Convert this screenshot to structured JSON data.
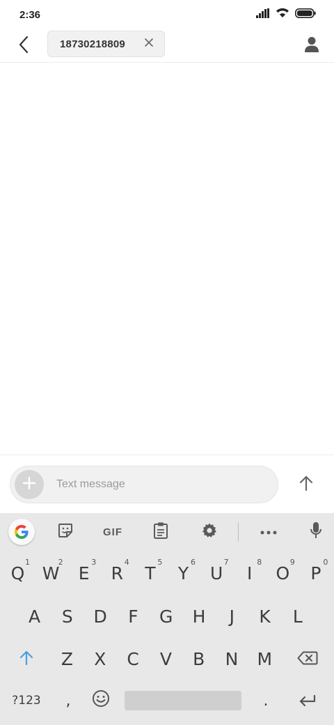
{
  "status_bar": {
    "time": "2:36",
    "icons": [
      "signal-icon",
      "wifi-icon",
      "battery-icon"
    ]
  },
  "header": {
    "back_icon": "arrow-back-icon",
    "recipient": "18730218809",
    "chip_close_icon": "close-icon",
    "contact_icon": "person-icon"
  },
  "compose": {
    "attach_icon": "plus-icon",
    "placeholder": "Text message",
    "value": "",
    "send_icon": "arrow-up-icon"
  },
  "keyboard": {
    "toolbar": {
      "gif_label": "GIF",
      "icons": [
        "google-icon",
        "sticker-icon",
        "gif-icon",
        "clipboard-icon",
        "settings-icon",
        "more-icon",
        "mic-icon"
      ]
    },
    "row1": [
      {
        "key": "Q",
        "hint": "1"
      },
      {
        "key": "W",
        "hint": "2"
      },
      {
        "key": "E",
        "hint": "3"
      },
      {
        "key": "R",
        "hint": "4"
      },
      {
        "key": "T",
        "hint": "5"
      },
      {
        "key": "Y",
        "hint": "6"
      },
      {
        "key": "U",
        "hint": "7"
      },
      {
        "key": "I",
        "hint": "8"
      },
      {
        "key": "O",
        "hint": "9"
      },
      {
        "key": "P",
        "hint": "0"
      }
    ],
    "row2": [
      "A",
      "S",
      "D",
      "F",
      "G",
      "H",
      "J",
      "K",
      "L"
    ],
    "row3": [
      "Z",
      "X",
      "C",
      "V",
      "B",
      "N",
      "M"
    ],
    "row4": {
      "symbols": "?123",
      "comma": ",",
      "period": ".",
      "enter_icon": "enter-icon",
      "emoji_icon": "emoji-icon",
      "shift_icon": "shift-icon",
      "backspace_icon": "backspace-icon"
    },
    "colors": {
      "background": "#e8e8e8",
      "shift_accent": "#4a9fe0"
    }
  }
}
